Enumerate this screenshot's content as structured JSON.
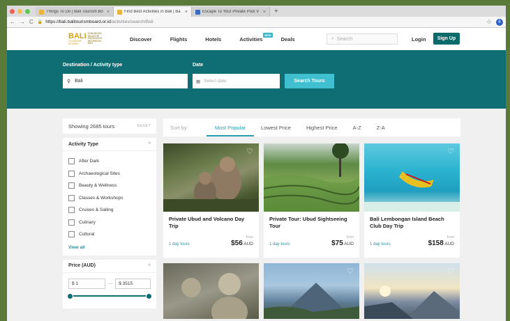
{
  "browser": {
    "tabs": [
      {
        "title": "Things To Do | Bali Tourism Bo",
        "active": false
      },
      {
        "title": "Find Best Activities in Bali | Ba",
        "active": true
      },
      {
        "title": "Escape To Your Private Pool V",
        "active": false
      }
    ],
    "url_host": "https://bali.balitourismboard.or.id",
    "url_path": "/activities/search/Bali",
    "new_tab": "+",
    "profile_initial": "6"
  },
  "site": {
    "logo_main": "BALI",
    "logo_sub1": "TOURISM",
    "logo_sub2": "BOARD",
    "logo_small1": "GABUNGAN",
    "logo_small2": "INDUSTRI",
    "logo_small3": "PARIWISATA",
    "logo_small4": "INDONESIA",
    "logo_small5": "BALI",
    "nav": [
      "Discover",
      "Flights",
      "Hotels",
      "Activities",
      "Deals"
    ],
    "new_badge": "NEW",
    "search_placeholder": "Search",
    "login": "Login",
    "signup": "Sign Up"
  },
  "searchband": {
    "dest_label": "Destination / Activity type",
    "dest_value": "Bali",
    "date_label": "Date",
    "date_placeholder": "Select date",
    "search_button": "Search Tours"
  },
  "sidebar": {
    "showing": "Showing 2685 tours",
    "reset": "RESET",
    "activity_type_title": "Activity Type",
    "activity_types": [
      "After Dark",
      "Archaeological Sites",
      "Beauty & Wellness",
      "Classes & Workshops",
      "Cruises & Sailing",
      "Culinary",
      "Cultural"
    ],
    "view_all": "View all",
    "price_title": "Price (AUD)",
    "price_min": "$ 1",
    "price_max": "$ 3515",
    "price_sep": "—"
  },
  "sort": {
    "label": "Sort by:",
    "options": [
      "Most Popular",
      "Lowest Price",
      "Highest Price",
      "A-Z",
      "Z-A"
    ],
    "active": "Most Popular"
  },
  "cards": [
    {
      "title": "Private Ubud and Volcano Day Trip",
      "from": "from",
      "days": "1 day tours",
      "price": "$56",
      "currency": "AUD"
    },
    {
      "title": "Private Tour: Ubud Sightseeing Tour",
      "from": "from",
      "days": "1 day tours",
      "price": "$75",
      "currency": "AUD"
    },
    {
      "title": "Bali Lembongan Island Beach Club Day Trip",
      "from": "from",
      "days": "1 day tours",
      "price": "$158",
      "currency": "AUD"
    }
  ],
  "colors": {
    "teal": "#0e6e73",
    "accent": "#2a9fb0",
    "gold": "#d4a017"
  }
}
